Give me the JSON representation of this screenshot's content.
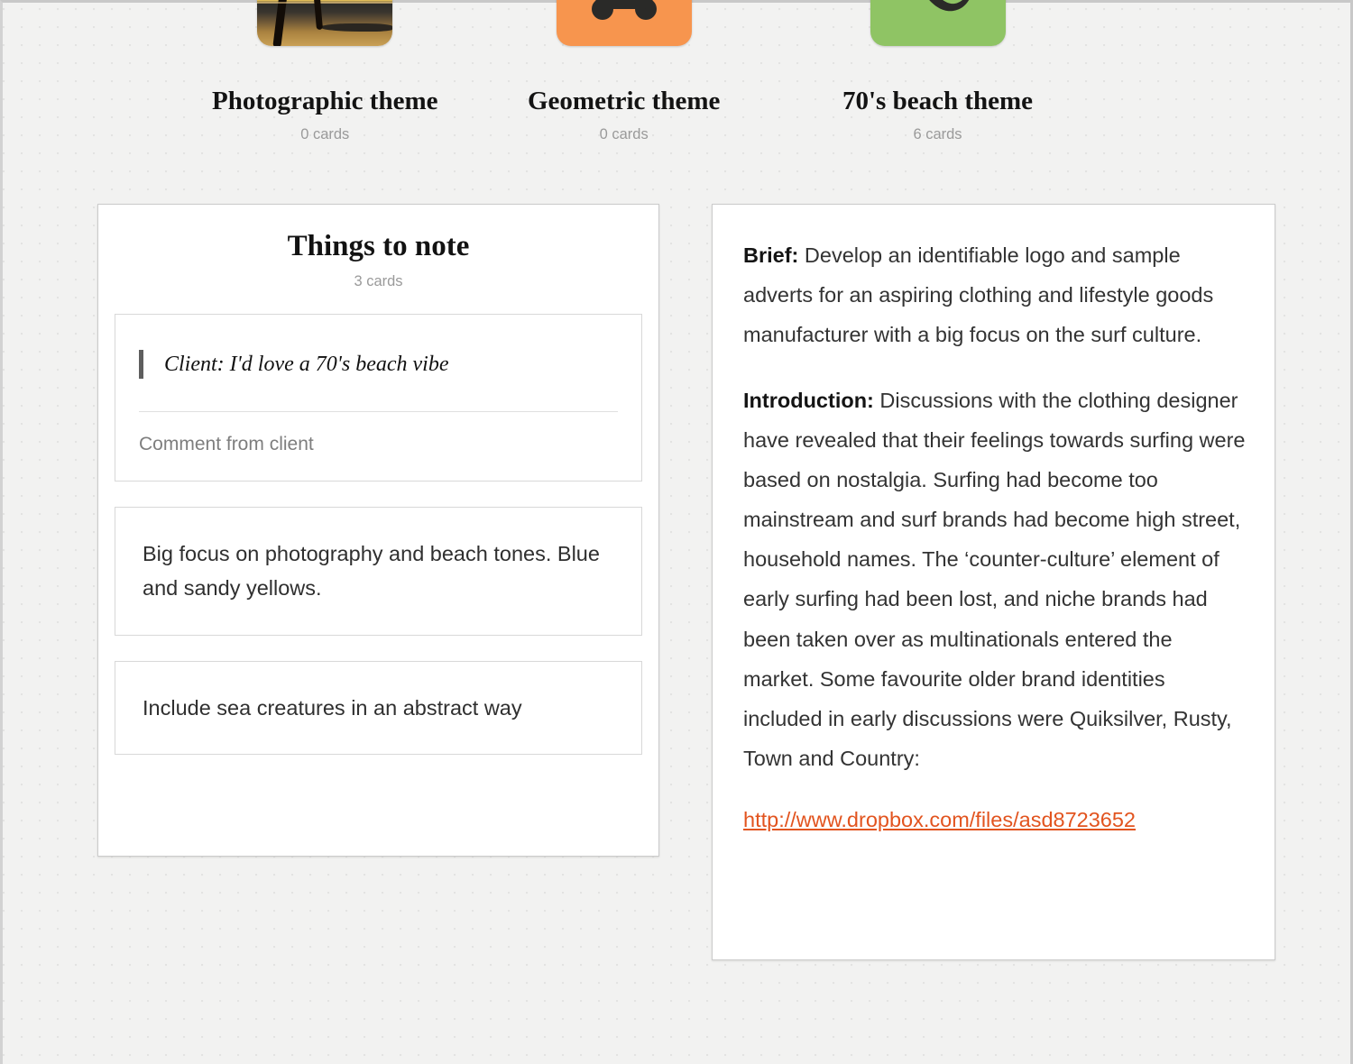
{
  "themes": [
    {
      "name": "Photographic theme",
      "count": "0 cards",
      "icon": "beach-sunset-photo-thumbnail",
      "color": "#000000"
    },
    {
      "name": "Geometric theme",
      "count": "0 cards",
      "icon": "bone-shape-icon",
      "color": "#f7954e"
    },
    {
      "name": "70's beach theme",
      "count": "6 cards",
      "icon": "wave-swoosh-icon",
      "color": "#8fc464"
    }
  ],
  "notes_panel": {
    "title": "Things to note",
    "count": "3 cards",
    "cards": [
      {
        "type": "quote",
        "quote": "Client: I'd love a 70's beach vibe",
        "meta": "Comment from client"
      },
      {
        "type": "text",
        "body": "Big focus on photography and beach tones. Blue and sandy yellows."
      },
      {
        "type": "text",
        "body": "Include sea creatures in an abstract way"
      }
    ]
  },
  "brief_panel": {
    "paragraphs": [
      {
        "label": "Brief:",
        "text": " Develop an identifiable logo and sample adverts for an aspiring clothing and lifestyle goods manufacturer with a big focus on the surf culture."
      },
      {
        "label": "Introduction:",
        "text": " Discussions with the clothing designer have revealed that their feelings towards surfing were based on nostalgia. Surfing had become too mainstream and surf brands had become high street, household names. The ‘counter-culture’ element of early surfing had been lost, and niche brands had been taken over as multinationals entered the market. Some favourite older brand identities included in early discussions were Quiksilver, Rusty, Town and Country:"
      }
    ],
    "link": "http://www.dropbox.com/files/asd8723652",
    "link_color": "#e2541f"
  }
}
